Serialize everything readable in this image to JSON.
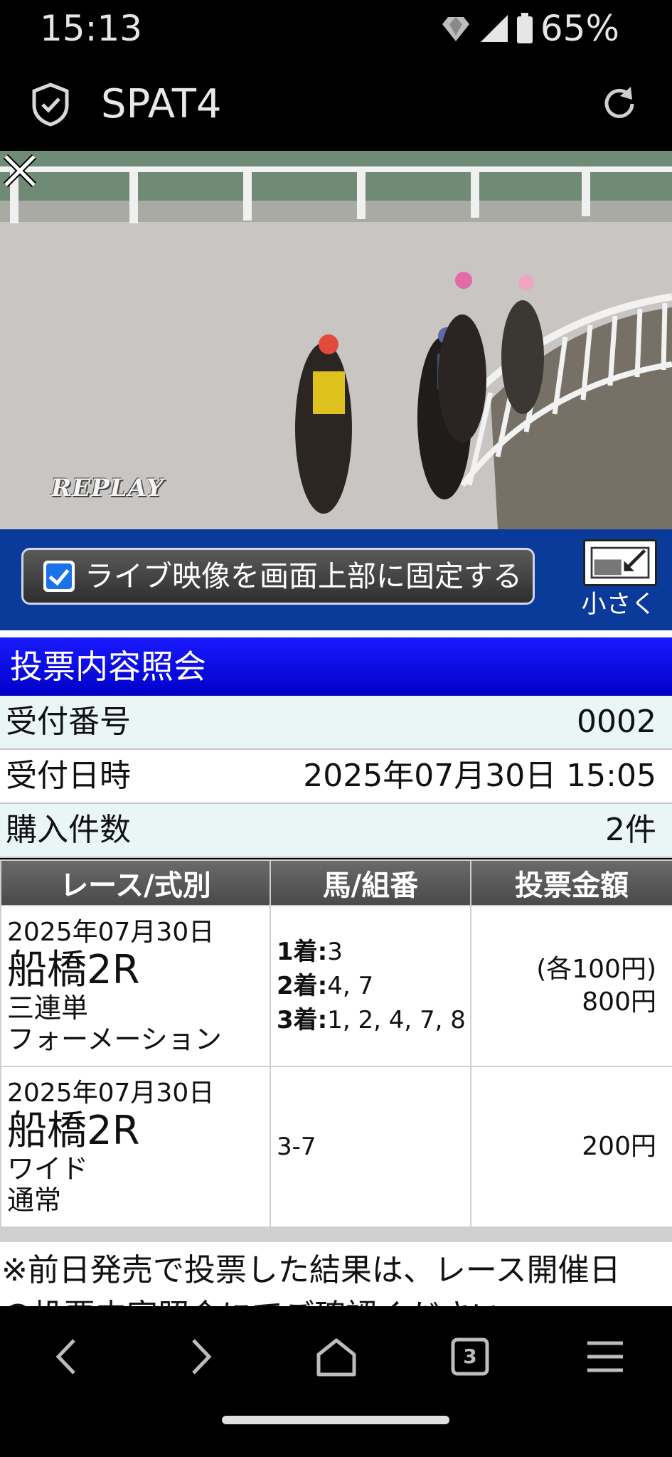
{
  "status_bar": {
    "time": "15:13",
    "battery_pct": "65%",
    "icons": [
      "data-icon",
      "signal-icon",
      "battery-icon"
    ]
  },
  "app_bar": {
    "title": "SPAT4",
    "icons": [
      "shield-check-icon",
      "reload-icon"
    ]
  },
  "video": {
    "overlay_text": "REPLAY",
    "icons": [
      "close-icon"
    ]
  },
  "pin_bar": {
    "checkbox_label": "ライブ映像を画面上部に固定する",
    "checked": true,
    "shrink_label": "小さく"
  },
  "section": {
    "title": "投票内容照会"
  },
  "info": [
    {
      "label": "受付番号",
      "value": "0002"
    },
    {
      "label": "受付日時",
      "value": "2025年07月30日 15:05"
    },
    {
      "label": "購入件数",
      "value": "2件"
    }
  ],
  "bets": {
    "headers": [
      "レース/式別",
      "馬/組番",
      "投票金額"
    ],
    "rows": [
      {
        "date": "2025年07月30日",
        "race": "船橋2R",
        "type": "三連単",
        "method": "フォーメーション",
        "lines": [
          {
            "label": "1着:",
            "value": "3"
          },
          {
            "label": "2着:",
            "value": "4, 7"
          },
          {
            "label": "3着:",
            "value": "1, 2, 4, 7, 8"
          }
        ],
        "unit": "(各100円)",
        "amount": "800円"
      },
      {
        "date": "2025年07月30日",
        "race": "船橋2R",
        "type": "ワイド",
        "method": "通常",
        "combo": "3-7",
        "amount": "200円"
      }
    ]
  },
  "note": {
    "line1": "※前日発売で投票した結果は、レース開催日",
    "line2": "の投票内容照会にてご確認ください。"
  },
  "bottom_nav": {
    "tab_count": "3",
    "icons": [
      "back-icon",
      "forward-icon",
      "home-icon",
      "tabs-icon",
      "menu-icon"
    ]
  }
}
